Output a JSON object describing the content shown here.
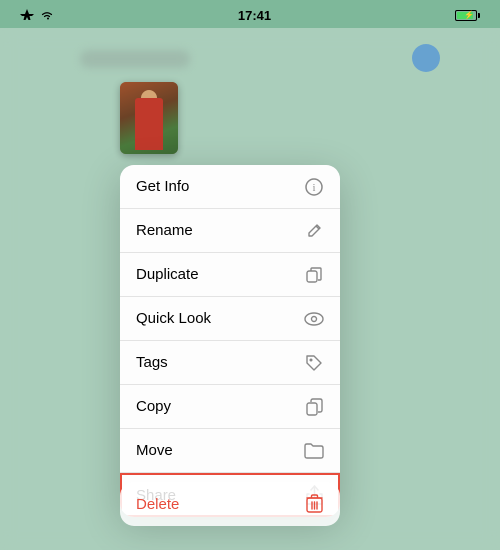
{
  "statusBar": {
    "time": "17:41",
    "signal": true,
    "wifi": true,
    "battery": true
  },
  "contextMenu": {
    "items": [
      {
        "id": "get-info",
        "label": "Get Info",
        "icon": "info"
      },
      {
        "id": "rename",
        "label": "Rename",
        "icon": "pencil"
      },
      {
        "id": "duplicate",
        "label": "Duplicate",
        "icon": "duplicate"
      },
      {
        "id": "quick-look",
        "label": "Quick Look",
        "icon": "eye"
      },
      {
        "id": "tags",
        "label": "Tags",
        "icon": "tag"
      },
      {
        "id": "copy",
        "label": "Copy",
        "icon": "copy"
      },
      {
        "id": "move",
        "label": "Move",
        "icon": "folder"
      },
      {
        "id": "share",
        "label": "Share",
        "icon": "share",
        "highlighted": true
      }
    ],
    "destructiveItems": [
      {
        "id": "delete",
        "label": "Delete",
        "icon": "trash"
      }
    ]
  }
}
